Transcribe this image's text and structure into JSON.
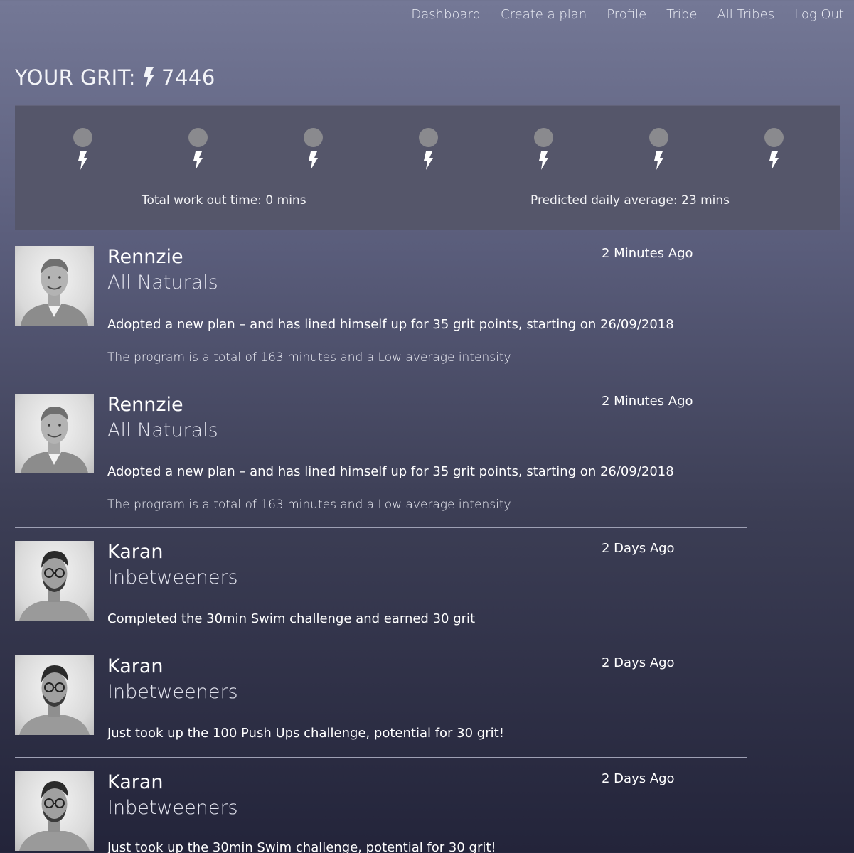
{
  "nav": {
    "items": [
      "Dashboard",
      "Create a plan",
      "Profile",
      "Tribe",
      "All Tribes",
      "Log Out"
    ]
  },
  "grit": {
    "label": "YOUR GRIT:",
    "value": "7446"
  },
  "week_panel": {
    "day_count": 7,
    "dot_color": "#8a8a8e",
    "total_label": "Total work out time: 0 mins",
    "predicted_label": "Predicted daily average: 23 mins"
  },
  "feed": [
    {
      "name": "Rennzie",
      "tribe": "All Naturals",
      "time": "2 Minutes Ago",
      "action": "Adopted a new plan – and has lined himself up for 35 grit points, starting on 26/09/2018",
      "detail": "The program is a total of 163 minutes and a Low average intensity"
    },
    {
      "name": "Rennzie",
      "tribe": "All Naturals",
      "time": "2 Minutes Ago",
      "action": "Adopted a new plan – and has lined himself up for 35 grit points, starting on 26/09/2018",
      "detail": "The program is a total of 163 minutes and a Low average intensity"
    },
    {
      "name": "Karan",
      "tribe": "Inbetweeners",
      "time": "2 Days Ago",
      "action": "Completed the 30min Swim challenge and earned 30 grit"
    },
    {
      "name": "Karan",
      "tribe": "Inbetweeners",
      "time": "2 Days Ago",
      "action": "Just took up the 100 Push Ups challenge, potential for 30 grit!"
    },
    {
      "name": "Karan",
      "tribe": "Inbetweeners",
      "time": "2 Days Ago",
      "action": "Just took up the 30min Swim challenge, potential for 30 grit!"
    }
  ]
}
